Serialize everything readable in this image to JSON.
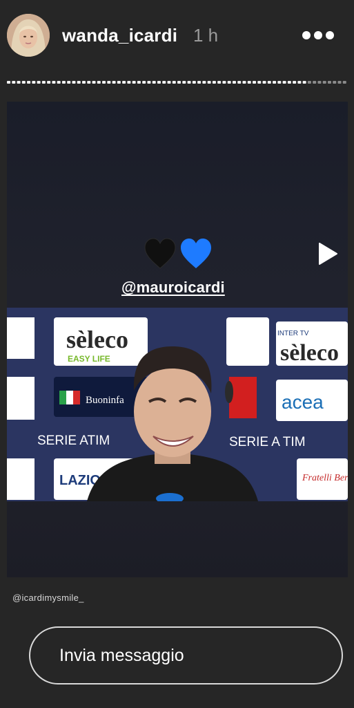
{
  "story": {
    "username": "wanda_icardi",
    "time_ago": "1 h",
    "hearts": [
      "🖤",
      "💙"
    ],
    "mention": "@mauroicardi",
    "credit": "@icardimysmile_"
  },
  "video": {
    "board_texts": [
      "sèleco",
      "EASY LIFE",
      "Buoninfa",
      "SERIE ATIM",
      "acea",
      "LAZIO",
      "Fratelli Beretta",
      "INTER TV",
      "SERIE A TIM"
    ]
  },
  "composer": {
    "placeholder": "Invia messaggio"
  },
  "colors": {
    "background": "#262626",
    "text": "#ffffff",
    "muted": "#9a9a9a",
    "heart_blue": "#1e7bff",
    "heart_black": "#111111"
  },
  "icons": {
    "more": "more-horizontal-icon",
    "play": "play-icon",
    "hearts": "heart-icon"
  }
}
